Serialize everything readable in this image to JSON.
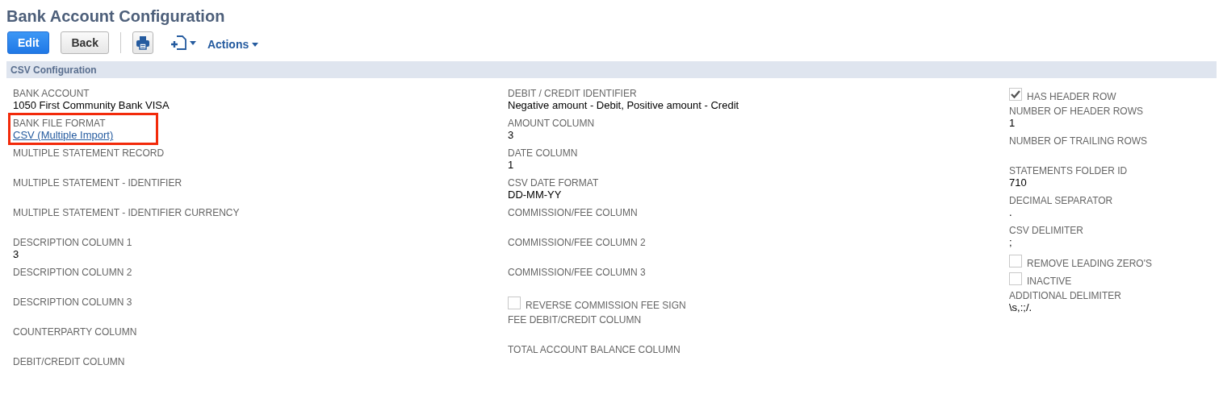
{
  "title": "Bank Account Configuration",
  "toolbar": {
    "edit": "Edit",
    "back": "Back",
    "actions": "Actions"
  },
  "section": {
    "title": "CSV Configuration",
    "columns": [
      [
        {
          "kind": "text",
          "label": "BANK ACCOUNT",
          "value": "1050 First Community Bank VISA",
          "highlighted": false
        },
        {
          "kind": "link",
          "label": "BANK FILE FORMAT",
          "value": "CSV (Multiple Import)",
          "highlighted": true
        },
        {
          "kind": "text",
          "label": "MULTIPLE STATEMENT RECORD",
          "highlighted": false
        },
        {
          "kind": "text",
          "label": "MULTIPLE STATEMENT - IDENTIFIER",
          "highlighted": false
        },
        {
          "kind": "text",
          "label": "MULTIPLE STATEMENT - IDENTIFIER CURRENCY",
          "highlighted": false
        },
        {
          "kind": "text",
          "label": "DESCRIPTION COLUMN 1",
          "value": "3",
          "highlighted": false
        },
        {
          "kind": "text",
          "label": "DESCRIPTION COLUMN 2",
          "highlighted": false
        },
        {
          "kind": "text",
          "label": "DESCRIPTION COLUMN 3",
          "highlighted": false
        },
        {
          "kind": "text",
          "label": "COUNTERPARTY COLUMN",
          "highlighted": false
        },
        {
          "kind": "text",
          "label": "DEBIT/CREDIT COLUMN",
          "highlighted": false
        }
      ],
      [
        {
          "kind": "text",
          "label": "DEBIT / CREDIT IDENTIFIER",
          "value": "Negative amount - Debit, Positive amount - Credit",
          "highlighted": false
        },
        {
          "kind": "text",
          "label": "AMOUNT COLUMN",
          "value": "3",
          "highlighted": false
        },
        {
          "kind": "text",
          "label": "DATE COLUMN",
          "value": "1",
          "highlighted": false
        },
        {
          "kind": "text",
          "label": "CSV DATE FORMAT",
          "value": "DD-MM-YY",
          "highlighted": false
        },
        {
          "kind": "text",
          "label": "COMMISSION/FEE COLUMN",
          "highlighted": false
        },
        {
          "kind": "text",
          "label": "COMMISSION/FEE COLUMN 2",
          "highlighted": false
        },
        {
          "kind": "text",
          "label": "COMMISSION/FEE COLUMN 3",
          "highlighted": false
        },
        {
          "kind": "checkbox",
          "label": "REVERSE COMMISSION FEE SIGN",
          "checked": false,
          "highlighted": false
        },
        {
          "kind": "text",
          "label": "FEE DEBIT/CREDIT COLUMN",
          "highlighted": false
        },
        {
          "kind": "text",
          "label": "TOTAL ACCOUNT BALANCE COLUMN",
          "highlighted": false
        }
      ],
      [
        {
          "kind": "checkbox",
          "label": "HAS HEADER ROW",
          "checked": true,
          "highlighted": false
        },
        {
          "kind": "text",
          "label": "NUMBER OF HEADER ROWS",
          "value": "1",
          "highlighted": false
        },
        {
          "kind": "text",
          "label": "NUMBER OF TRAILING ROWS",
          "highlighted": false
        },
        {
          "kind": "text",
          "label": "STATEMENTS FOLDER ID",
          "value": "710",
          "highlighted": false
        },
        {
          "kind": "text",
          "label": "DECIMAL SEPARATOR",
          "value": ".",
          "highlighted": false
        },
        {
          "kind": "text",
          "label": "CSV DELIMITER",
          "value": ";",
          "highlighted": false
        },
        {
          "kind": "checkbox",
          "label": "REMOVE LEADING ZERO'S",
          "checked": false,
          "highlighted": false
        },
        {
          "kind": "checkbox",
          "label": "INACTIVE",
          "checked": false,
          "highlighted": false
        },
        {
          "kind": "text",
          "label": "ADDITIONAL DELIMITER",
          "value": "\\s,:;/.",
          "highlighted": false
        }
      ]
    ]
  }
}
